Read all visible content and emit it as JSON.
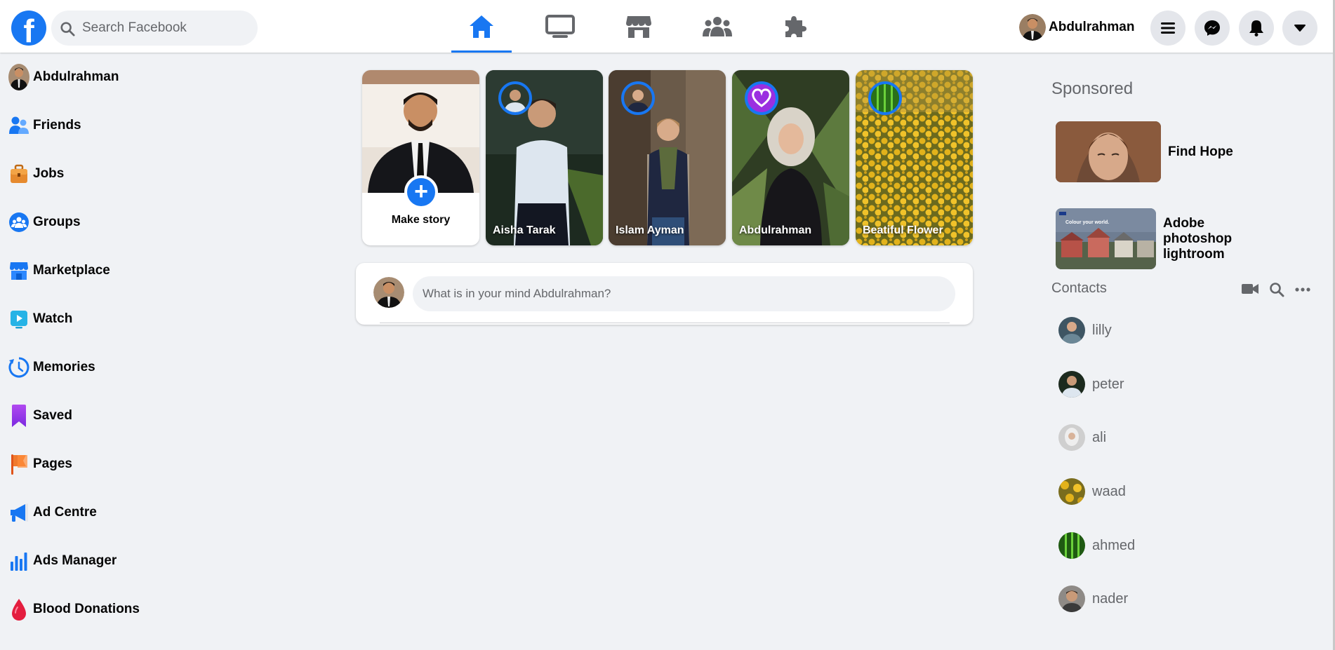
{
  "app": {
    "title": "Facebook"
  },
  "colors": {
    "brand": "#1877f2",
    "background": "#f0f2f5",
    "muted_text": "#65676b"
  },
  "header": {
    "logo_icon": "facebook-logo-icon",
    "search": {
      "placeholder": "Search Facebook",
      "icon": "search-icon"
    },
    "nav_tabs": [
      {
        "name": "home",
        "icon": "home-icon",
        "active": true
      },
      {
        "name": "watch",
        "icon": "tv-icon",
        "active": false
      },
      {
        "name": "marketplace",
        "icon": "store-icon",
        "active": false
      },
      {
        "name": "groups",
        "icon": "people-icon",
        "active": false
      },
      {
        "name": "gaming",
        "icon": "puzzle-icon",
        "active": false
      }
    ],
    "profile_name": "Abdulrahman",
    "action_buttons": [
      "menu-icon",
      "messenger-icon",
      "bell-icon",
      "caret-down-icon"
    ]
  },
  "sidebar": {
    "items": [
      {
        "label": "Abdulrahman",
        "icon": "avatar"
      },
      {
        "label": "Friends",
        "icon": "friends-icon"
      },
      {
        "label": "Jobs",
        "icon": "briefcase-icon"
      },
      {
        "label": "Groups",
        "icon": "groups-icon"
      },
      {
        "label": "Marketplace",
        "icon": "marketplace-icon"
      },
      {
        "label": "Watch",
        "icon": "watch-icon"
      },
      {
        "label": "Memories",
        "icon": "clock-icon"
      },
      {
        "label": "Saved",
        "icon": "bookmark-icon"
      },
      {
        "label": "Pages",
        "icon": "flag-icon"
      },
      {
        "label": "Ad Centre",
        "icon": "megaphone-icon"
      },
      {
        "label": "Ads Manager",
        "icon": "bar-chart-icon"
      },
      {
        "label": "Blood Donations",
        "icon": "blood-drop-icon"
      }
    ]
  },
  "stories": {
    "make_story_label": "Make story",
    "items": [
      {
        "name": "Aisha Tarak",
        "ring_icon": "avatar"
      },
      {
        "name": "Islam Ayman",
        "ring_icon": "avatar"
      },
      {
        "name": "Abdulrahman",
        "ring_icon": "heart-icon"
      },
      {
        "name": "Beatiful Flower",
        "ring_icon": "avatar"
      }
    ]
  },
  "composer": {
    "placeholder": "What is in your mind Abdulrahman?"
  },
  "right": {
    "sponsored_title": "Sponsored",
    "ads": [
      {
        "title": "Find Hope"
      },
      {
        "title": "Adobe photoshop lightroom",
        "image_caption": "Colour your world."
      }
    ],
    "contacts_title": "Contacts",
    "contacts_icons": [
      "video-camera-icon",
      "search-icon",
      "more-icon"
    ],
    "contacts": [
      "lilly",
      "peter",
      "ali",
      "waad",
      "ahmed",
      "nader"
    ]
  }
}
